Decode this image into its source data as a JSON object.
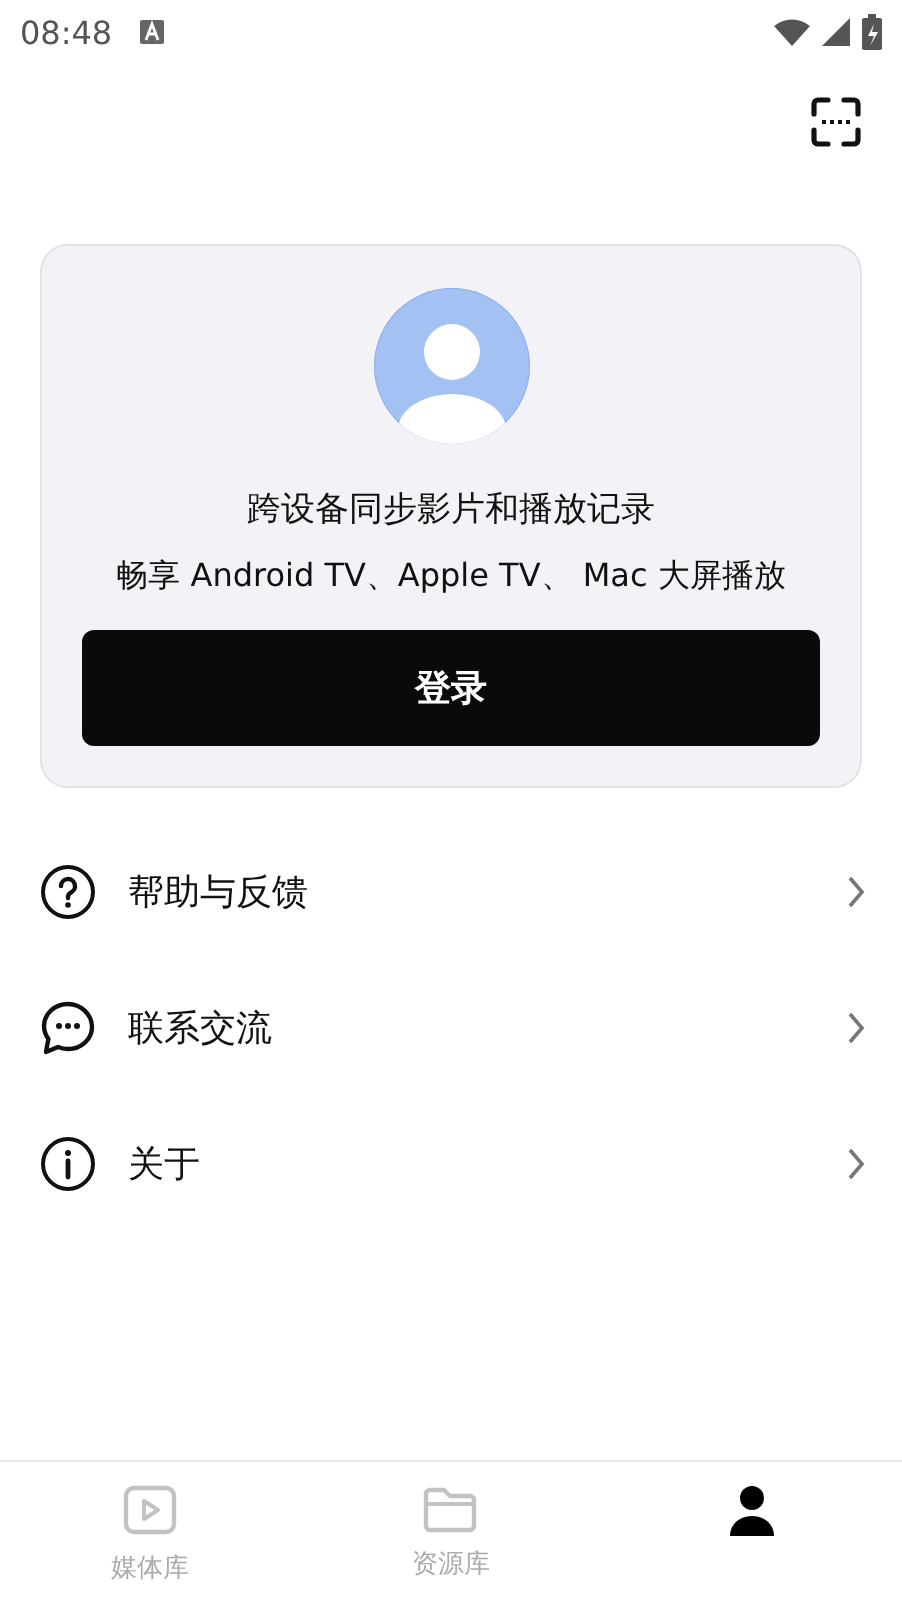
{
  "status_bar": {
    "time": "08:48"
  },
  "login_card": {
    "line_1": "跨设备同步影片和播放记录",
    "line_2": "畅享 Android TV、Apple TV、 Mac 大屏播放",
    "button": "登录"
  },
  "menu": [
    {
      "kind": "help",
      "label": "帮助与反馈"
    },
    {
      "kind": "chat",
      "label": "联系交流"
    },
    {
      "kind": "info",
      "label": "关于"
    }
  ],
  "tabs": [
    {
      "kind": "media",
      "label": "媒体库",
      "selected": false
    },
    {
      "kind": "folder",
      "label": "资源库",
      "selected": false
    },
    {
      "kind": "profile",
      "selected": true
    }
  ]
}
